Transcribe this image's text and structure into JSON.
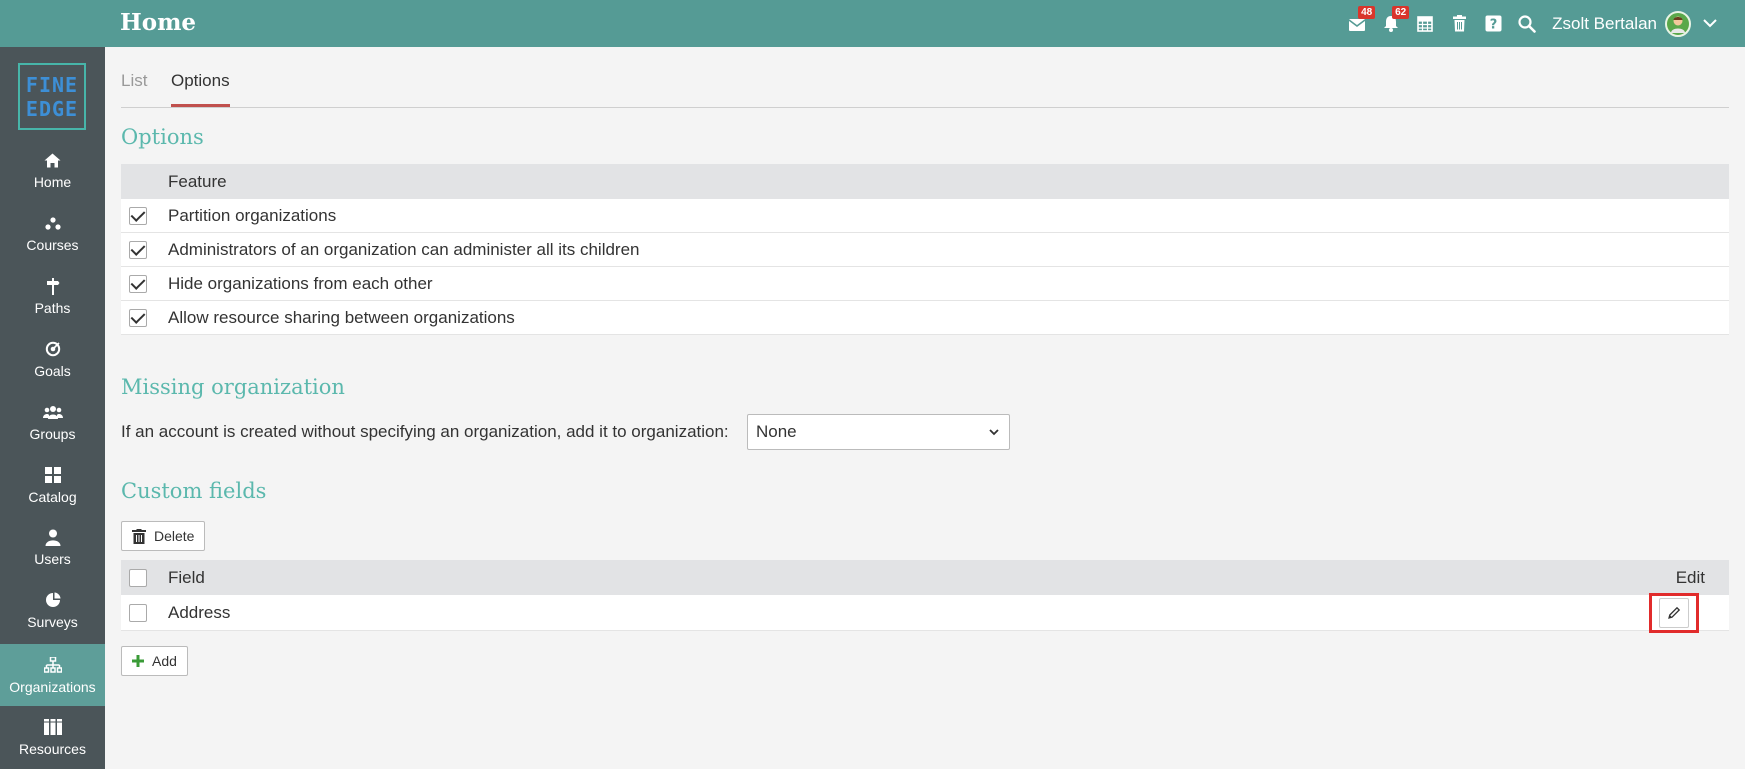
{
  "header": {
    "title": "Home",
    "messages_badge": "48",
    "notifications_badge": "62",
    "user_name": "Zsolt Bertalan"
  },
  "logo": {
    "line1": "FINE",
    "line2": "EDGE"
  },
  "sidebar": {
    "items": [
      {
        "label": "Home",
        "icon": "home-icon"
      },
      {
        "label": "Courses",
        "icon": "courses-icon"
      },
      {
        "label": "Paths",
        "icon": "signpost-icon"
      },
      {
        "label": "Goals",
        "icon": "target-icon"
      },
      {
        "label": "Groups",
        "icon": "groups-icon"
      },
      {
        "label": "Catalog",
        "icon": "grid-icon"
      },
      {
        "label": "Users",
        "icon": "user-icon"
      },
      {
        "label": "Surveys",
        "icon": "pie-icon"
      },
      {
        "label": "Organizations",
        "icon": "org-chart-icon"
      },
      {
        "label": "Resources",
        "icon": "books-icon"
      }
    ],
    "active": "Organizations"
  },
  "tabs": {
    "list": "List",
    "options": "Options"
  },
  "options": {
    "title": "Options",
    "header": "Feature",
    "rows": [
      {
        "label": "Partition organizations",
        "checked": true
      },
      {
        "label": "Administrators of an organization can administer all its children",
        "checked": true
      },
      {
        "label": "Hide organizations from each other",
        "checked": true
      },
      {
        "label": "Allow resource sharing between organizations",
        "checked": true
      }
    ]
  },
  "missing": {
    "title": "Missing organization",
    "label": "If an account is created without specifying an organization, add it to organization:",
    "selected": "None"
  },
  "custom_fields": {
    "title": "Custom fields",
    "delete_label": "Delete",
    "header_field": "Field",
    "header_edit": "Edit",
    "rows": [
      {
        "label": "Address"
      }
    ],
    "add_label": "Add"
  },
  "colors": {
    "topbar": "#559b95",
    "sidebar": "#4b5559",
    "accent": "#5bb8ad",
    "highlight": "#e12b2b"
  }
}
